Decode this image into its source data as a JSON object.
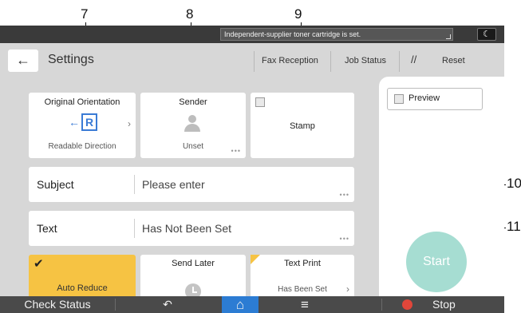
{
  "callouts": [
    "7",
    "8",
    "9",
    "10",
    "11"
  ],
  "status": {
    "message": "Independent-supplier toner cartridge is set."
  },
  "header": {
    "back_glyph": "←",
    "title": "Settings",
    "fax_reception": "Fax Reception",
    "job_status": "Job Status",
    "reset_icon": "//",
    "reset": "Reset"
  },
  "tiles": {
    "orientation": {
      "label": "Original Orientation",
      "sub": "Readable Direction"
    },
    "sender": {
      "label": "Sender",
      "sub": "Unset"
    },
    "stamp": {
      "label": "Stamp"
    },
    "auto_reduce": {
      "label": "Auto Reduce",
      "accent": "#f6c343"
    },
    "send_later": {
      "label": "Send Later"
    },
    "text_print": {
      "label": "Text Print",
      "sub": "Has Been Set"
    }
  },
  "rows": {
    "subject": {
      "label": "Subject",
      "value": "Please enter"
    },
    "text": {
      "label": "Text",
      "value": "Has Not Been Set"
    }
  },
  "right_panel": {
    "preview": "Preview",
    "start": "Start",
    "start_color": "#a6ddd2"
  },
  "bottom_bar": {
    "check_status": "Check Status",
    "back_icon": "↶",
    "home_icon": "⌂",
    "menu_icon": "≡",
    "stop": "Stop",
    "home_color": "#2c7cd3",
    "stop_icon_color": "#e0463a"
  }
}
